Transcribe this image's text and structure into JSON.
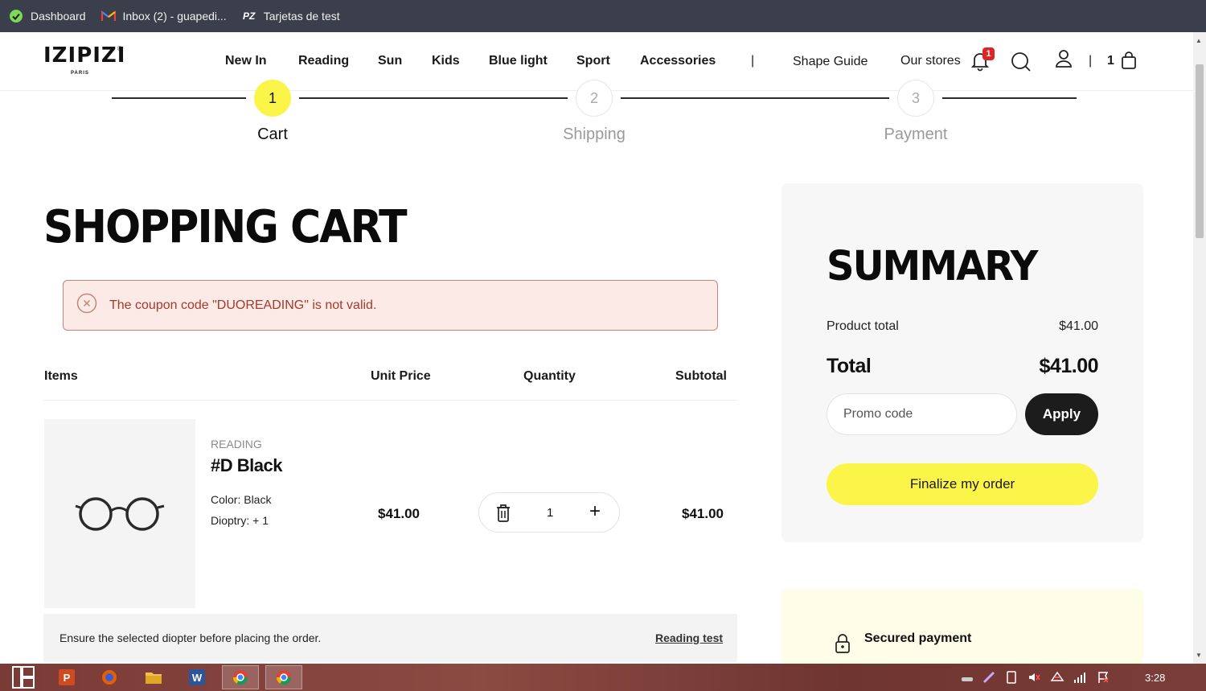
{
  "bookmarks": [
    {
      "label": "Dashboard",
      "icon": "check-circle-icon"
    },
    {
      "label": "Inbox (2) - guapedi...",
      "icon": "gmail-icon"
    },
    {
      "label": "Tarjetas de test",
      "icon": "pz-icon"
    }
  ],
  "header": {
    "logo": "IZIPIZI",
    "logo_sub": "PARIS",
    "nav": [
      "New In",
      "Reading",
      "Sun",
      "Kids",
      "Blue light",
      "Sport",
      "Accessories"
    ],
    "shape_guide": "Shape Guide",
    "our_stores": "Our stores",
    "notification_count": "1",
    "cart_count": "1"
  },
  "stepper": {
    "steps": [
      {
        "number": "1",
        "label": "Cart",
        "active": true
      },
      {
        "number": "2",
        "label": "Shipping",
        "active": false
      },
      {
        "number": "3",
        "label": "Payment",
        "active": false
      }
    ]
  },
  "cart": {
    "title": "SHOPPING CART",
    "alert": "The coupon code \"DUOREADING\" is not valid.",
    "columns": {
      "items": "Items",
      "unit_price": "Unit Price",
      "quantity": "Quantity",
      "subtotal": "Subtotal"
    },
    "product": {
      "category": "READING",
      "name": "#D Black",
      "color": "Color: Black",
      "dioptry": "Dioptry: + 1",
      "unit_price": "$41.00",
      "quantity": "1",
      "subtotal": "$41.00"
    },
    "notice": "Ensure the selected diopter before placing the order.",
    "reading_test": "Reading test"
  },
  "summary": {
    "title": "SUMMARY",
    "product_total_label": "Product total",
    "product_total_value": "$41.00",
    "total_label": "Total",
    "total_value": "$41.00",
    "promo_placeholder": "Promo code",
    "apply": "Apply",
    "finalize": "Finalize my order",
    "secured": "Secured payment"
  },
  "taskbar": {
    "clock": "3:28"
  },
  "colors": {
    "accent_yellow": "#fbf54a",
    "alert_bg": "#fbeae6",
    "alert_text": "#a43a2c",
    "bookmarks_bg": "#3b3e4b"
  }
}
